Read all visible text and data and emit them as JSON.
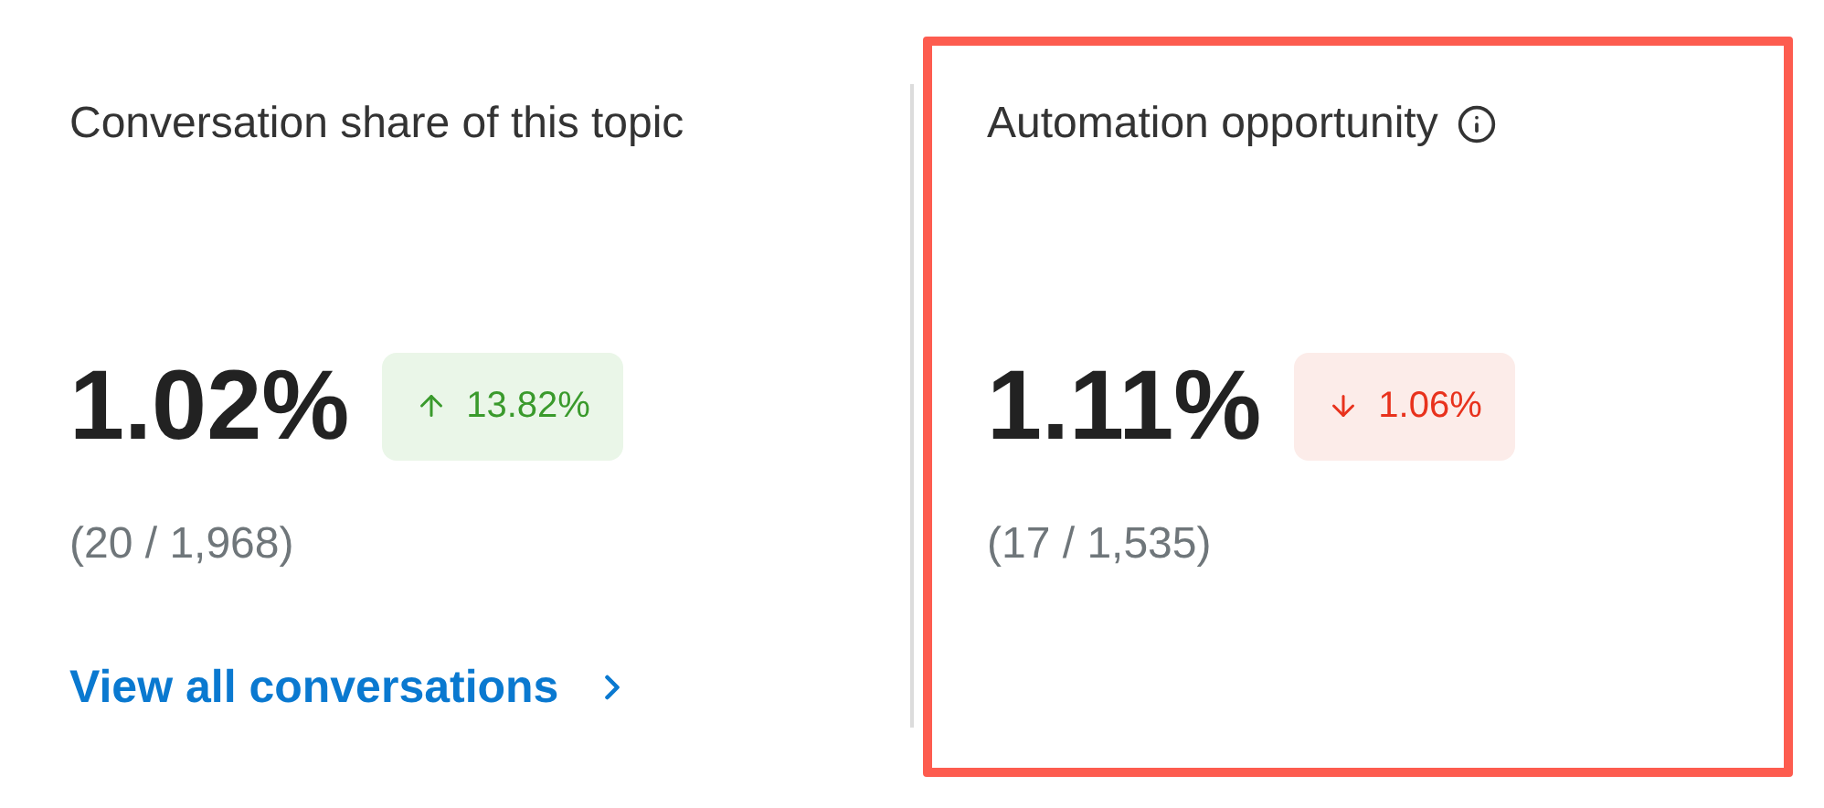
{
  "metrics": [
    {
      "title": "Conversation share of this topic",
      "info": false,
      "highlighted": false,
      "value": "1.02%",
      "change": {
        "rising": true,
        "text": "13.82%"
      },
      "ratio": "(20 / 1,968)",
      "link": "View all conversations"
    },
    {
      "title": "Automation opportunity",
      "info": true,
      "highlighted": true,
      "value": "1.11%",
      "change": {
        "rising": false,
        "text": "1.06%"
      },
      "ratio": "(17 / 1,535)"
    }
  ]
}
